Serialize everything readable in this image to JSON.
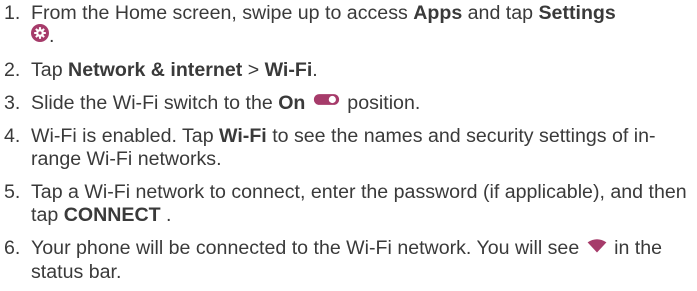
{
  "colors": {
    "text": "#3a3a3a",
    "accent": "#a63b6a"
  },
  "steps": [
    {
      "number": "1.",
      "t1": "From the Home screen, swipe up to access ",
      "b1": "Apps",
      "t2": " and tap ",
      "b2": "Settings",
      "icon": "settings-gear-icon",
      "t3": "."
    },
    {
      "number": "2.",
      "t1": "Tap ",
      "b1": "Network & internet",
      "t2": " > ",
      "b2": "Wi-Fi",
      "t3": "."
    },
    {
      "number": "3.",
      "t1": "Slide the Wi-Fi switch to the ",
      "b1": "On",
      "icon": "toggle-on-icon",
      "t2": " position."
    },
    {
      "number": "4.",
      "t1": "Wi-Fi is enabled. Tap ",
      "b1": "Wi-Fi",
      "t2": " to see the names and security settings of in-range Wi-Fi networks."
    },
    {
      "number": "5.",
      "t1": "Tap a Wi-Fi network to connect, enter the password (if applicable), and then tap ",
      "b1": "CONNECT",
      "t2": " ."
    },
    {
      "number": "6.",
      "t1": "Your phone will be connected to the Wi-Fi network. You will see ",
      "icon": "wifi-signal-icon",
      "t2": " in the status bar."
    }
  ]
}
